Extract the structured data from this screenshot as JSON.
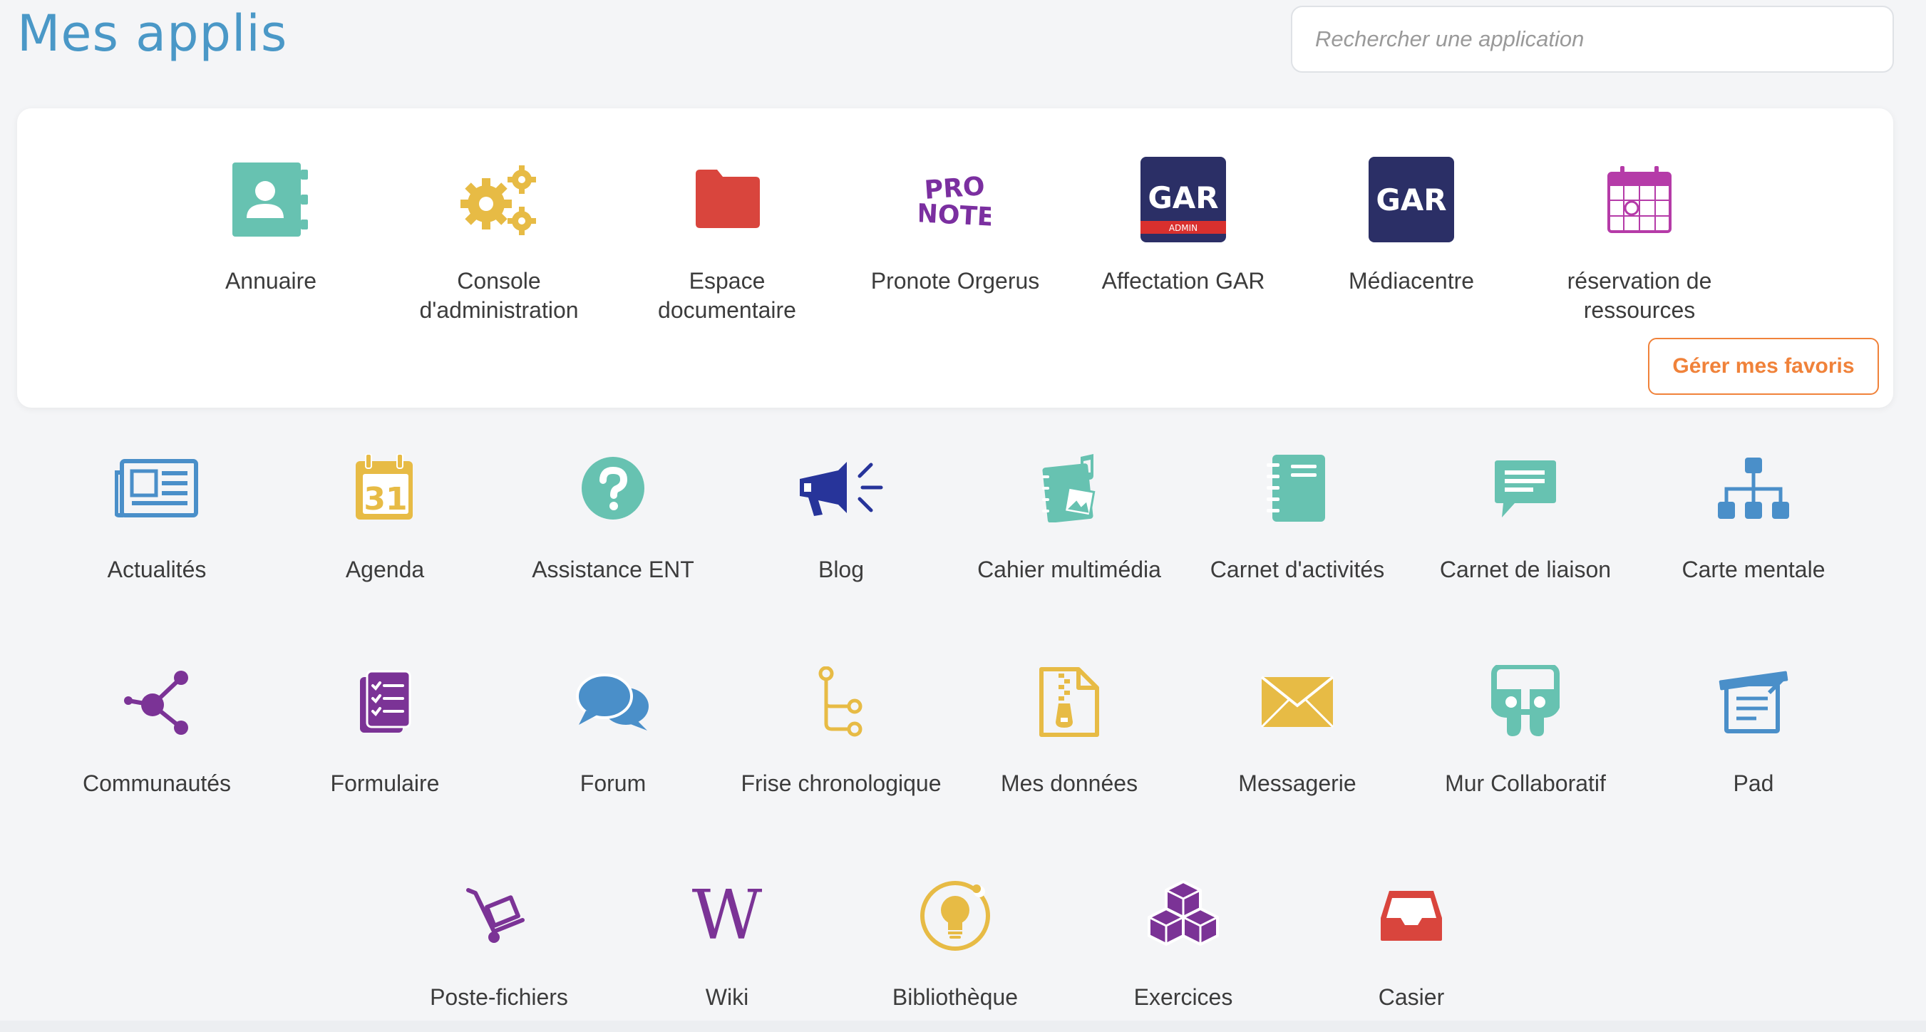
{
  "page": {
    "title": "Mes applis"
  },
  "search": {
    "placeholder": "Rechercher une application"
  },
  "favorites": {
    "manage_label": "Gérer mes favoris",
    "apps": [
      {
        "label": "Annuaire",
        "icon": "contact-card-icon",
        "color": "#67c2b1"
      },
      {
        "label": "Console d'administration",
        "icon": "gears-icon",
        "color": "#e7bb45"
      },
      {
        "label": "Espace documentaire",
        "icon": "folder-icon",
        "color": "#d9453d"
      },
      {
        "label": "Pronote Orgerus",
        "icon": "pronote-logo-icon",
        "color": "#7b2fa0"
      },
      {
        "label": "Affectation GAR",
        "icon": "gar-admin-logo-icon",
        "color": "#2b2f66"
      },
      {
        "label": "Médiacentre",
        "icon": "gar-logo-icon",
        "color": "#2b2f66"
      },
      {
        "label": "réservation de ressources",
        "icon": "calendar-reservation-icon",
        "color": "#b53ba8"
      }
    ]
  },
  "apps": [
    {
      "label": "Actualités",
      "icon": "newspaper-icon",
      "color": "#4a8fc9"
    },
    {
      "label": "Agenda",
      "icon": "agenda-calendar-icon",
      "color": "#e7bb45",
      "day": "31"
    },
    {
      "label": "Assistance ENT",
      "icon": "help-icon",
      "color": "#67c2b1"
    },
    {
      "label": "Blog",
      "icon": "megaphone-icon",
      "color": "#27349a"
    },
    {
      "label": "Cahier multimédia",
      "icon": "multimedia-notebook-icon",
      "color": "#67c2b1"
    },
    {
      "label": "Carnet d'activités",
      "icon": "notebook-icon",
      "color": "#67c2b1"
    },
    {
      "label": "Carnet de liaison",
      "icon": "message-bubble-icon",
      "color": "#67c2b1"
    },
    {
      "label": "Carte mentale",
      "icon": "mindmap-icon",
      "color": "#4a8fc9"
    },
    {
      "label": "Communautés",
      "icon": "share-nodes-icon",
      "color": "#7b3396"
    },
    {
      "label": "Formulaire",
      "icon": "checklist-icon",
      "color": "#7b3396"
    },
    {
      "label": "Forum",
      "icon": "chat-bubbles-icon",
      "color": "#4a8fc9"
    },
    {
      "label": "Frise chronologique",
      "icon": "timeline-icon",
      "color": "#e7bb45"
    },
    {
      "label": "Mes données",
      "icon": "zip-file-icon",
      "color": "#e7bb45"
    },
    {
      "label": "Messagerie",
      "icon": "envelope-icon",
      "color": "#e7bb45"
    },
    {
      "label": "Mur Collaboratif",
      "icon": "collaborative-wall-icon",
      "color": "#67c2b1"
    },
    {
      "label": "Pad",
      "icon": "pad-icon",
      "color": "#4a8fc9"
    },
    {
      "label": "Poste-fichiers",
      "icon": "hand-truck-icon",
      "color": "#7b3396"
    },
    {
      "label": "Wiki",
      "icon": "wikipedia-icon",
      "color": "#7b3396"
    },
    {
      "label": "Bibliothèque",
      "icon": "lightbulb-icon",
      "color": "#e7bb45"
    },
    {
      "label": "Exercices",
      "icon": "cubes-icon",
      "color": "#7b3396"
    },
    {
      "label": "Casier",
      "icon": "inbox-tray-icon",
      "color": "#d9453d"
    }
  ]
}
